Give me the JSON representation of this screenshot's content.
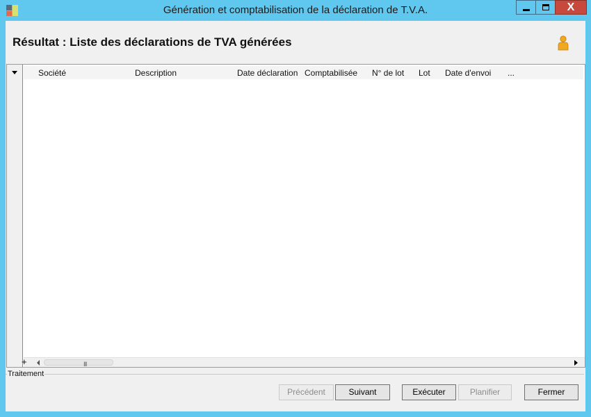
{
  "window": {
    "title": "Génération et comptabilisation de la déclaration de T.V.A.",
    "close_glyph": "X"
  },
  "header": {
    "title": "Résultat : Liste des déclarations de TVA générées"
  },
  "grid": {
    "columns": [
      "Société",
      "Description",
      "Date déclaration",
      "Comptabilisée",
      "N° de lot",
      "Lot",
      "Date d'envoi",
      "..."
    ],
    "rows": [],
    "add_glyph": "+",
    "scroll_grip": "III"
  },
  "group": {
    "label": "Traitement"
  },
  "buttons": {
    "previous": "Précédent",
    "next": "Suivant",
    "execute": "Exécuter",
    "schedule": "Planifier",
    "close": "Fermer"
  },
  "colors": {
    "window_frame": "#60c8ef",
    "close_button": "#c7483c",
    "user_icon": "#f0a820"
  }
}
